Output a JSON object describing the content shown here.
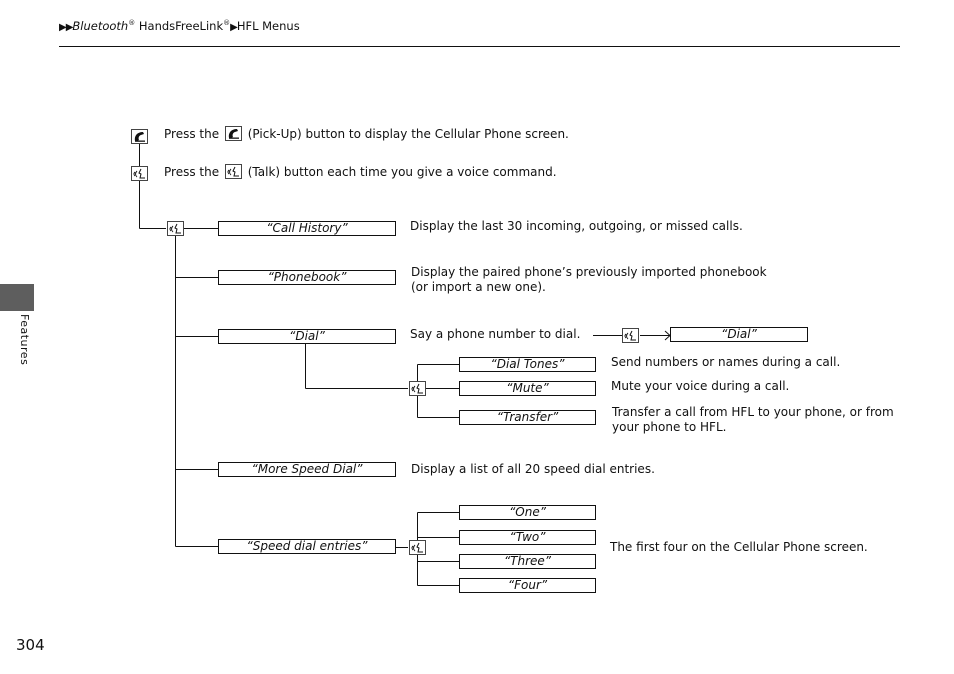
{
  "breadcrumb": {
    "arrows": "▶▶",
    "part1": "Bluetooth",
    "reg": "®",
    "part2": " HandsFreeLink",
    "sep": "▶",
    "part3": "HFL Menus"
  },
  "side_tab": {
    "label": "Features"
  },
  "page_number": "304",
  "icons": {
    "pickup": "pickup-phone-icon",
    "talk": "talk-voice-icon",
    "pickup_glyph": "☎",
    "talk_glyph": "ɞ͜"
  },
  "intro": {
    "pickup_pre": "Press the",
    "pickup_post": "(Pick-Up) button to display the Cellular Phone screen.",
    "talk_pre": "Press the",
    "talk_post": "(Talk) button each time you give a voice command."
  },
  "commands": [
    {
      "label": "“Call History”",
      "desc": "Display the last 30 incoming, outgoing, or missed calls."
    },
    {
      "label": "“Phonebook”",
      "desc": "Display the paired phone’s previously imported phonebook",
      "desc2": "(or import a new one)."
    },
    {
      "label": "“Dial”",
      "desc": "Say a phone number to dial.",
      "next": "“Dial”"
    },
    {
      "label": "“More Speed Dial”",
      "desc": "Display a list of all 20 speed dial entries."
    },
    {
      "label": "“Speed dial entries”"
    }
  ],
  "dial_sub": [
    {
      "label": "“Dial Tones”",
      "desc": "Send numbers or names during a call."
    },
    {
      "label": "“Mute”",
      "desc": "Mute your voice during a call."
    },
    {
      "label": "“Transfer”",
      "desc": "Transfer a call from HFL to your phone, or from",
      "desc2": "your phone to HFL."
    }
  ],
  "speed_sub": {
    "items": [
      "“One”",
      "“Two”",
      "“Three”",
      "“Four”"
    ],
    "desc": "The first four on the Cellular Phone screen."
  }
}
